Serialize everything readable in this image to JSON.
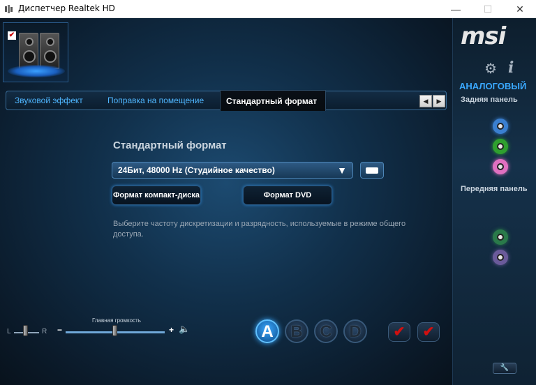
{
  "window": {
    "title": "Диспетчер Realtek HD",
    "controls": {
      "minimize": "—",
      "maximize": "☐",
      "close": "✕"
    }
  },
  "tabs": {
    "items": [
      {
        "label": "Звуковой эффект"
      },
      {
        "label": "Поправка на помещение"
      },
      {
        "label": "Стандартный формат",
        "active": true
      }
    ],
    "prev": "◀",
    "next": "▶"
  },
  "format": {
    "heading": "Стандартный формат",
    "selected": "24Бит, 48000 Hz (Студийное качество)",
    "cd_button": "Формат компакт-диска",
    "dvd_button": "Формат DVD",
    "description": "Выберите частоту дискретизации и разрядность, используемые в режиме общего доступа."
  },
  "bottom": {
    "balance_left": "L",
    "balance_right": "R",
    "volume_label": "Главная громкость",
    "volume_minus": "−",
    "volume_plus": "+",
    "volume_icon": "🔈",
    "profiles": [
      "A",
      "B",
      "C",
      "D"
    ],
    "ok_glyph": "✔",
    "cancel_glyph": "✔"
  },
  "right_panel": {
    "logo": "msi",
    "mode": "АНАЛОГОВЫЙ",
    "rear_label": "Задняя панель",
    "front_label": "Передняя панель",
    "rear_jacks": [
      "#3a7fd0",
      "#2fa02f",
      "#e070c0"
    ],
    "front_jacks": [
      "#2a7a4a",
      "#6a5a9a"
    ]
  },
  "colors": {
    "accent": "#3aa8ff",
    "error": "#d01010"
  }
}
